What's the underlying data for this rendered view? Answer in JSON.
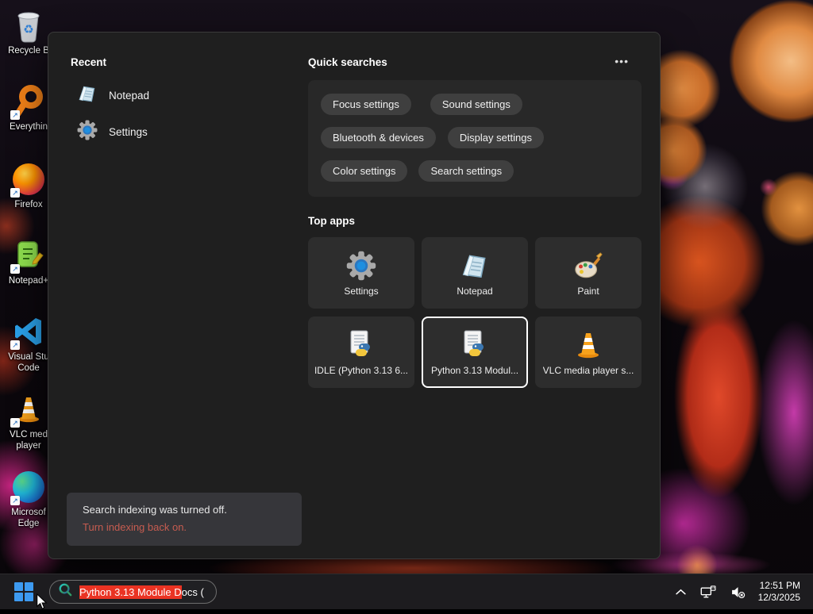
{
  "colors": {
    "accent_blue": "#3d9af0",
    "search_highlight_red": "#ea3323",
    "notice_link_red": "#c65c50",
    "selected_tile_border": "#ffffff"
  },
  "desktop": {
    "icons": [
      {
        "id": "recycle-bin",
        "label": "Recycle B"
      },
      {
        "id": "everything",
        "label": "Everythin"
      },
      {
        "id": "firefox",
        "label": "Firefox"
      },
      {
        "id": "notepad-plus-plus",
        "label": "Notepad+"
      },
      {
        "id": "visual-studio-code",
        "label": "Visual Stu\nCode"
      },
      {
        "id": "vlc-media-player",
        "label": "VLC med\nplayer"
      },
      {
        "id": "microsoft-edge",
        "label": "Microsof\nEdge"
      }
    ]
  },
  "panel": {
    "recent": {
      "title": "Recent",
      "items": [
        {
          "label": "Notepad",
          "icon": "notepad-icon"
        },
        {
          "label": "Settings",
          "icon": "settings-gear-icon"
        }
      ]
    },
    "quick_searches": {
      "title": "Quick searches",
      "more_icon": "•••",
      "pills": [
        "Focus settings",
        "Sound settings",
        "Bluetooth & devices",
        "Display settings",
        "Color settings",
        "Search settings"
      ]
    },
    "top_apps": {
      "title": "Top apps",
      "tiles": [
        {
          "label": "Settings",
          "icon": "settings-gear-icon",
          "selected": false
        },
        {
          "label": "Notepad",
          "icon": "notepad-icon",
          "selected": false
        },
        {
          "label": "Paint",
          "icon": "paint-palette-icon",
          "selected": false
        },
        {
          "label": "IDLE (Python 3.13 6...",
          "icon": "python-doc-icon",
          "selected": false
        },
        {
          "label": "Python 3.13 Modul...",
          "icon": "python-doc-icon",
          "selected": true
        },
        {
          "label": "VLC media player s...",
          "icon": "vlc-cone-icon",
          "selected": false
        }
      ]
    },
    "notice": {
      "message": "Search indexing was turned off.",
      "link": "Turn indexing back on."
    }
  },
  "taskbar": {
    "search": {
      "highlighted_text": "Python 3.13 Module D",
      "rest_text": "ocs ("
    },
    "tray": {
      "time": "12:51 PM",
      "date": "12/3/2025"
    }
  }
}
